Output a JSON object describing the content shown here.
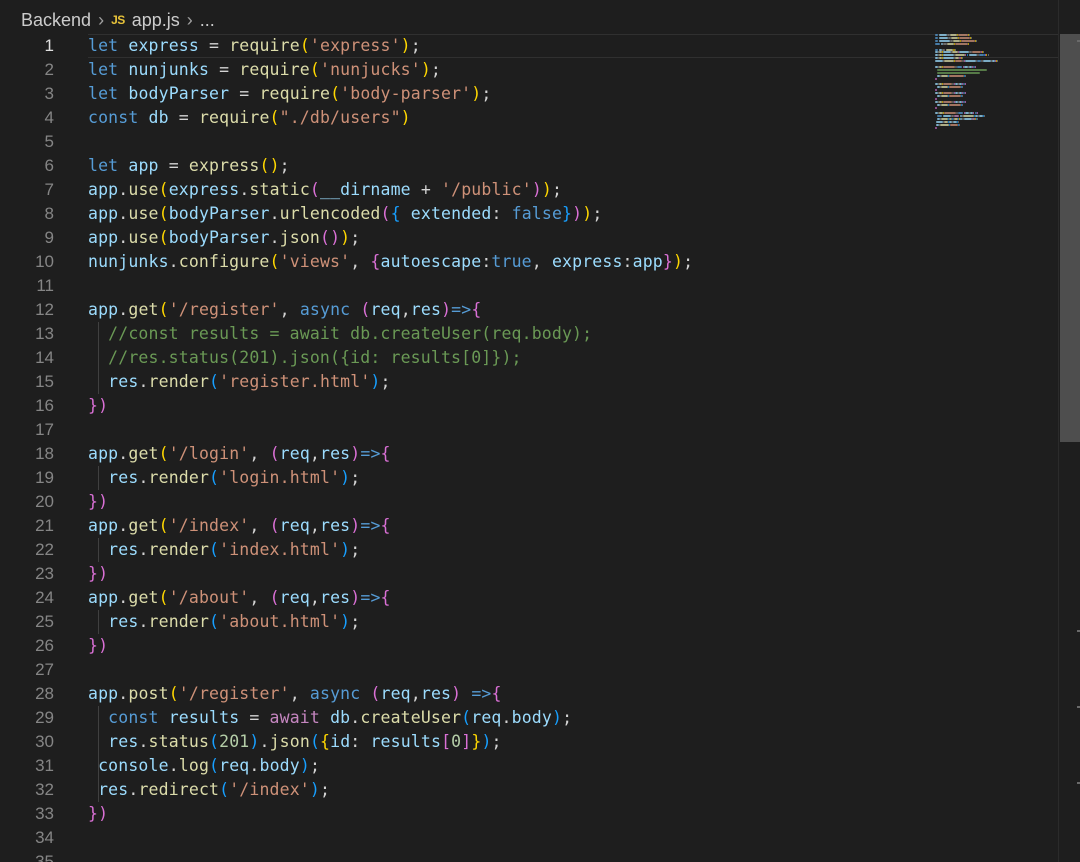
{
  "breadcrumb": {
    "folder": "Backend",
    "file_icon": "JS",
    "file": "app.js",
    "more": "..."
  },
  "active_line": 1,
  "lines": [
    {
      "n": "1"
    },
    {
      "n": "2"
    },
    {
      "n": "3"
    },
    {
      "n": "4"
    },
    {
      "n": "5"
    },
    {
      "n": "6"
    },
    {
      "n": "7"
    },
    {
      "n": "8"
    },
    {
      "n": "9"
    },
    {
      "n": "10"
    },
    {
      "n": "11"
    },
    {
      "n": "12"
    },
    {
      "n": "13"
    },
    {
      "n": "14"
    },
    {
      "n": "15"
    },
    {
      "n": "16"
    },
    {
      "n": "17"
    },
    {
      "n": "18"
    },
    {
      "n": "19"
    },
    {
      "n": "20"
    },
    {
      "n": "21"
    },
    {
      "n": "22"
    },
    {
      "n": "23"
    },
    {
      "n": "24"
    },
    {
      "n": "25"
    },
    {
      "n": "26"
    },
    {
      "n": "27"
    },
    {
      "n": "28"
    },
    {
      "n": "29"
    },
    {
      "n": "30"
    },
    {
      "n": "31"
    },
    {
      "n": "32"
    },
    {
      "n": "33"
    },
    {
      "n": "34"
    },
    {
      "n": "35"
    }
  ],
  "code": [
    [
      [
        "kw",
        "let"
      ],
      [
        "pl",
        " "
      ],
      [
        "var",
        "express"
      ],
      [
        "op",
        " = "
      ],
      [
        "fn",
        "require"
      ],
      [
        "b1",
        "("
      ],
      [
        "str",
        "'express'"
      ],
      [
        "b1",
        ")"
      ],
      [
        "pl",
        ";"
      ]
    ],
    [
      [
        "kw",
        "let"
      ],
      [
        "pl",
        " "
      ],
      [
        "var",
        "nunjunks"
      ],
      [
        "op",
        " = "
      ],
      [
        "fn",
        "require"
      ],
      [
        "b1",
        "("
      ],
      [
        "str",
        "'nunjucks'"
      ],
      [
        "b1",
        ")"
      ],
      [
        "pl",
        ";"
      ]
    ],
    [
      [
        "kw",
        "let"
      ],
      [
        "pl",
        " "
      ],
      [
        "var",
        "bodyParser"
      ],
      [
        "op",
        " = "
      ],
      [
        "fn",
        "require"
      ],
      [
        "b1",
        "("
      ],
      [
        "str",
        "'body-parser'"
      ],
      [
        "b1",
        ")"
      ],
      [
        "pl",
        ";"
      ]
    ],
    [
      [
        "kw",
        "const"
      ],
      [
        "pl",
        " "
      ],
      [
        "var",
        "db"
      ],
      [
        "op",
        " = "
      ],
      [
        "fn",
        "require"
      ],
      [
        "b1",
        "("
      ],
      [
        "str",
        "\"./db/users\""
      ],
      [
        "b1",
        ")"
      ]
    ],
    [],
    [
      [
        "kw",
        "let"
      ],
      [
        "pl",
        " "
      ],
      [
        "var",
        "app"
      ],
      [
        "op",
        " = "
      ],
      [
        "fn",
        "express"
      ],
      [
        "b1",
        "()"
      ],
      [
        "pl",
        ";"
      ]
    ],
    [
      [
        "var",
        "app"
      ],
      [
        "pl",
        "."
      ],
      [
        "fn",
        "use"
      ],
      [
        "b1",
        "("
      ],
      [
        "var",
        "express"
      ],
      [
        "pl",
        "."
      ],
      [
        "fn",
        "static"
      ],
      [
        "b2",
        "("
      ],
      [
        "var",
        "__dirname"
      ],
      [
        "op",
        " + "
      ],
      [
        "str",
        "'/public'"
      ],
      [
        "b2",
        ")"
      ],
      [
        "b1",
        ")"
      ],
      [
        "pl",
        ";"
      ]
    ],
    [
      [
        "var",
        "app"
      ],
      [
        "pl",
        "."
      ],
      [
        "fn",
        "use"
      ],
      [
        "b1",
        "("
      ],
      [
        "var",
        "bodyParser"
      ],
      [
        "pl",
        "."
      ],
      [
        "fn",
        "urlencoded"
      ],
      [
        "b2",
        "("
      ],
      [
        "b3",
        "{"
      ],
      [
        "pl",
        " "
      ],
      [
        "var",
        "extended"
      ],
      [
        "pl",
        ": "
      ],
      [
        "bool",
        "false"
      ],
      [
        "b3",
        "}"
      ],
      [
        "b2",
        ")"
      ],
      [
        "b1",
        ")"
      ],
      [
        "pl",
        ";"
      ]
    ],
    [
      [
        "var",
        "app"
      ],
      [
        "pl",
        "."
      ],
      [
        "fn",
        "use"
      ],
      [
        "b1",
        "("
      ],
      [
        "var",
        "bodyParser"
      ],
      [
        "pl",
        "."
      ],
      [
        "fn",
        "json"
      ],
      [
        "b2",
        "()"
      ],
      [
        "b1",
        ")"
      ],
      [
        "pl",
        ";"
      ]
    ],
    [
      [
        "var",
        "nunjunks"
      ],
      [
        "pl",
        "."
      ],
      [
        "fn",
        "configure"
      ],
      [
        "b1",
        "("
      ],
      [
        "str",
        "'views'"
      ],
      [
        "pl",
        ", "
      ],
      [
        "b2",
        "{"
      ],
      [
        "var",
        "autoescape"
      ],
      [
        "pl",
        ":"
      ],
      [
        "bool",
        "true"
      ],
      [
        "pl",
        ", "
      ],
      [
        "var",
        "express"
      ],
      [
        "pl",
        ":"
      ],
      [
        "var",
        "app"
      ],
      [
        "b2",
        "}"
      ],
      [
        "b1",
        ")"
      ],
      [
        "pl",
        ";"
      ]
    ],
    [],
    [
      [
        "var",
        "app"
      ],
      [
        "pl",
        "."
      ],
      [
        "fn",
        "get"
      ],
      [
        "b1",
        "("
      ],
      [
        "str",
        "'/register'"
      ],
      [
        "pl",
        ", "
      ],
      [
        "kw",
        "async"
      ],
      [
        "pl",
        " "
      ],
      [
        "b2",
        "("
      ],
      [
        "var",
        "req"
      ],
      [
        "pl",
        ","
      ],
      [
        "var",
        "res"
      ],
      [
        "b2",
        ")"
      ],
      [
        "kw",
        "=>"
      ],
      [
        "b2",
        "{"
      ]
    ],
    [
      [
        "pl",
        "  "
      ],
      [
        "cm",
        "//const results = await db.createUser(req.body);"
      ]
    ],
    [
      [
        "pl",
        "  "
      ],
      [
        "cm",
        "//res.status(201).json({id: results[0]});"
      ]
    ],
    [
      [
        "pl",
        "  "
      ],
      [
        "var",
        "res"
      ],
      [
        "pl",
        "."
      ],
      [
        "fn",
        "render"
      ],
      [
        "b3",
        "("
      ],
      [
        "str",
        "'register.html'"
      ],
      [
        "b3",
        ")"
      ],
      [
        "pl",
        ";"
      ]
    ],
    [
      [
        "b2",
        "})"
      ]
    ],
    [],
    [
      [
        "var",
        "app"
      ],
      [
        "pl",
        "."
      ],
      [
        "fn",
        "get"
      ],
      [
        "b1",
        "("
      ],
      [
        "str",
        "'/login'"
      ],
      [
        "pl",
        ", "
      ],
      [
        "b2",
        "("
      ],
      [
        "var",
        "req"
      ],
      [
        "pl",
        ","
      ],
      [
        "var",
        "res"
      ],
      [
        "b2",
        ")"
      ],
      [
        "kw",
        "=>"
      ],
      [
        "b2",
        "{"
      ]
    ],
    [
      [
        "pl",
        "  "
      ],
      [
        "var",
        "res"
      ],
      [
        "pl",
        "."
      ],
      [
        "fn",
        "render"
      ],
      [
        "b3",
        "("
      ],
      [
        "str",
        "'login.html'"
      ],
      [
        "b3",
        ")"
      ],
      [
        "pl",
        ";"
      ]
    ],
    [
      [
        "b2",
        "})"
      ]
    ],
    [
      [
        "var",
        "app"
      ],
      [
        "pl",
        "."
      ],
      [
        "fn",
        "get"
      ],
      [
        "b1",
        "("
      ],
      [
        "str",
        "'/index'"
      ],
      [
        "pl",
        ", "
      ],
      [
        "b2",
        "("
      ],
      [
        "var",
        "req"
      ],
      [
        "pl",
        ","
      ],
      [
        "var",
        "res"
      ],
      [
        "b2",
        ")"
      ],
      [
        "kw",
        "=>"
      ],
      [
        "b2",
        "{"
      ]
    ],
    [
      [
        "pl",
        "  "
      ],
      [
        "var",
        "res"
      ],
      [
        "pl",
        "."
      ],
      [
        "fn",
        "render"
      ],
      [
        "b3",
        "("
      ],
      [
        "str",
        "'index.html'"
      ],
      [
        "b3",
        ")"
      ],
      [
        "pl",
        ";"
      ]
    ],
    [
      [
        "b2",
        "})"
      ]
    ],
    [
      [
        "var",
        "app"
      ],
      [
        "pl",
        "."
      ],
      [
        "fn",
        "get"
      ],
      [
        "b1",
        "("
      ],
      [
        "str",
        "'/about'"
      ],
      [
        "pl",
        ", "
      ],
      [
        "b2",
        "("
      ],
      [
        "var",
        "req"
      ],
      [
        "pl",
        ","
      ],
      [
        "var",
        "res"
      ],
      [
        "b2",
        ")"
      ],
      [
        "kw",
        "=>"
      ],
      [
        "b2",
        "{"
      ]
    ],
    [
      [
        "pl",
        "  "
      ],
      [
        "var",
        "res"
      ],
      [
        "pl",
        "."
      ],
      [
        "fn",
        "render"
      ],
      [
        "b3",
        "("
      ],
      [
        "str",
        "'about.html'"
      ],
      [
        "b3",
        ")"
      ],
      [
        "pl",
        ";"
      ]
    ],
    [
      [
        "b2",
        "})"
      ]
    ],
    [],
    [
      [
        "var",
        "app"
      ],
      [
        "pl",
        "."
      ],
      [
        "fn",
        "post"
      ],
      [
        "b1",
        "("
      ],
      [
        "str",
        "'/register'"
      ],
      [
        "pl",
        ", "
      ],
      [
        "kw",
        "async"
      ],
      [
        "pl",
        " "
      ],
      [
        "b2",
        "("
      ],
      [
        "var",
        "req"
      ],
      [
        "pl",
        ","
      ],
      [
        "var",
        "res"
      ],
      [
        "b2",
        ")"
      ],
      [
        "pl",
        " "
      ],
      [
        "kw",
        "=>"
      ],
      [
        "b2",
        "{"
      ]
    ],
    [
      [
        "pl",
        "  "
      ],
      [
        "kw",
        "const"
      ],
      [
        "pl",
        " "
      ],
      [
        "var",
        "results"
      ],
      [
        "op",
        " = "
      ],
      [
        "kw2",
        "await"
      ],
      [
        "pl",
        " "
      ],
      [
        "var",
        "db"
      ],
      [
        "pl",
        "."
      ],
      [
        "fn",
        "createUser"
      ],
      [
        "b3",
        "("
      ],
      [
        "var",
        "req"
      ],
      [
        "pl",
        "."
      ],
      [
        "var",
        "body"
      ],
      [
        "b3",
        ")"
      ],
      [
        "pl",
        ";"
      ]
    ],
    [
      [
        "pl",
        "  "
      ],
      [
        "var",
        "res"
      ],
      [
        "pl",
        "."
      ],
      [
        "fn",
        "status"
      ],
      [
        "b3",
        "("
      ],
      [
        "num",
        "201"
      ],
      [
        "b3",
        ")"
      ],
      [
        "pl",
        "."
      ],
      [
        "fn",
        "json"
      ],
      [
        "b3",
        "("
      ],
      [
        "b1",
        "{"
      ],
      [
        "var",
        "id"
      ],
      [
        "pl",
        ": "
      ],
      [
        "var",
        "results"
      ],
      [
        "b2",
        "["
      ],
      [
        "num",
        "0"
      ],
      [
        "b2",
        "]"
      ],
      [
        "b1",
        "}"
      ],
      [
        "b3",
        ")"
      ],
      [
        "pl",
        ";"
      ]
    ],
    [
      [
        "pl",
        " "
      ],
      [
        "var",
        "console"
      ],
      [
        "pl",
        "."
      ],
      [
        "fn",
        "log"
      ],
      [
        "b3",
        "("
      ],
      [
        "var",
        "req"
      ],
      [
        "pl",
        "."
      ],
      [
        "var",
        "body"
      ],
      [
        "b3",
        ")"
      ],
      [
        "pl",
        ";"
      ]
    ],
    [
      [
        "pl",
        " "
      ],
      [
        "var",
        "res"
      ],
      [
        "pl",
        "."
      ],
      [
        "fn",
        "redirect"
      ],
      [
        "b3",
        "("
      ],
      [
        "str",
        "'/index'"
      ],
      [
        "b3",
        ")"
      ],
      [
        "pl",
        ";"
      ]
    ],
    [
      [
        "b2",
        "})"
      ]
    ],
    [],
    []
  ],
  "colors": {
    "background": "#1e1e1e",
    "keyword": "#569cd6",
    "variable": "#9cdcfe",
    "function": "#dcdcaa",
    "string": "#ce9178",
    "comment": "#6a9955",
    "number": "#b5cea8",
    "line_number": "#858585"
  }
}
